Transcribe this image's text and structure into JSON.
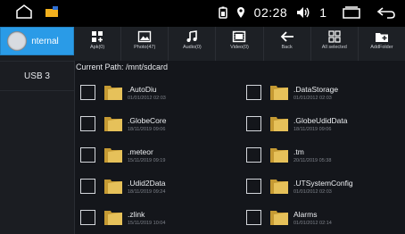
{
  "status": {
    "time": "02:28",
    "volume_level": "1"
  },
  "sidebar": {
    "items": [
      {
        "label": "Internal",
        "display": "nternal",
        "active": true
      },
      {
        "label": "USB 3",
        "active": false
      }
    ]
  },
  "toolbar": {
    "items": [
      {
        "label": "Apk(0)",
        "icon": "apk-icon"
      },
      {
        "label": "Photo(47)",
        "icon": "photo-icon"
      },
      {
        "label": "Audio(0)",
        "icon": "music-icon"
      },
      {
        "label": "Video(0)",
        "icon": "video-icon"
      },
      {
        "label": "Back",
        "icon": "back-arrow-icon"
      },
      {
        "label": "All selected",
        "icon": "select-all-icon"
      },
      {
        "label": "AddFolder",
        "icon": "add-folder-icon"
      }
    ]
  },
  "path": {
    "text": "Current Path: /mnt/sdcard"
  },
  "files": [
    {
      "name": ".AutoDiu",
      "date": "01/01/2012 02:03"
    },
    {
      "name": ".DataStorage",
      "date": "01/01/2012 02:03"
    },
    {
      "name": ".GlobeCore",
      "date": "18/11/2019 09:06"
    },
    {
      "name": ".GlobeUdidData",
      "date": "18/11/2019 09:06"
    },
    {
      "name": ".meteor",
      "date": "15/11/2019 09:19"
    },
    {
      "name": ".tm",
      "date": "20/11/2019 05:38"
    },
    {
      "name": ".Udid2Data",
      "date": "18/11/2019 09:24"
    },
    {
      "name": ".UTSystemConfig",
      "date": "01/01/2012 02:03"
    },
    {
      "name": ".zlink",
      "date": "15/11/2019 10:04"
    },
    {
      "name": "Alarms",
      "date": "01/01/2012 02:14"
    }
  ],
  "colors": {
    "accent": "#2a9be7",
    "folder": "#e6c15a",
    "background": "#14161b"
  }
}
